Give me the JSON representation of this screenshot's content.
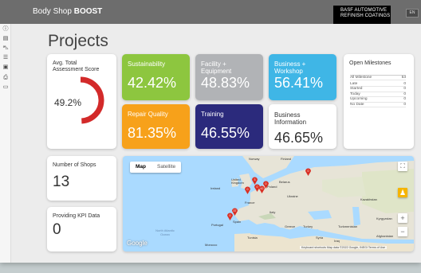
{
  "header": {
    "brand_light": "Body Shop ",
    "brand_bold": "BOOST",
    "partner_line1": "BASF AUTOMOTIVE",
    "partner_line2": "REFINISH COATINGS",
    "language": "EN"
  },
  "sidebar": {
    "icons": [
      "info-icon",
      "list-icon",
      "car-icon",
      "tasks-icon",
      "calendar-icon",
      "printer-icon",
      "monitor-icon"
    ]
  },
  "page": {
    "title": "Projects"
  },
  "assessment": {
    "label": "Avg. Total Assessment Score",
    "value": "49.2%",
    "fraction": 0.492,
    "color": "#d32a2a"
  },
  "kpis": [
    {
      "label": "Sustainability",
      "value": "42.42%",
      "color": "#8dc63f"
    },
    {
      "label": "Facility + Equipment",
      "value": "48.83%",
      "color": "#b1b3b6"
    },
    {
      "label": "Business + Workshop",
      "value": "56.41%",
      "color": "#3fb6e6"
    },
    {
      "label": "Repair Quality",
      "value": "81.35%",
      "color": "#f7a11a"
    },
    {
      "label": "Training",
      "value": "46.55%",
      "color": "#2b2a7c"
    },
    {
      "label": "Business Information",
      "value": "46.65%",
      "color": "#ffffff"
    }
  ],
  "milestones": {
    "title": "Open Milestones",
    "rows": [
      {
        "label": "All Milestone",
        "value": "53"
      },
      {
        "label": "Late",
        "value": "0"
      },
      {
        "label": "Started",
        "value": "0"
      },
      {
        "label": "Today",
        "value": "0"
      },
      {
        "label": "Upcoming",
        "value": "0"
      },
      {
        "label": "No Date",
        "value": "0"
      }
    ]
  },
  "shops": {
    "label": "Number of Shops",
    "value": "13"
  },
  "kpi_data": {
    "label": "Providing KPI Data",
    "value": "0"
  },
  "map": {
    "tab_map": "Map",
    "tab_satellite": "Satellite",
    "labels": {
      "norway": "Norway",
      "finland": "Finland",
      "ireland": "Ireland",
      "united_kingdom": "United Kingdom",
      "poland": "Poland",
      "belarus": "Belarus",
      "ukraine": "Ukraine",
      "kazakhstan": "Kazakhstan",
      "france": "France",
      "italy": "Italy",
      "portugal": "Portugal",
      "spain": "Spain",
      "greece": "Greece",
      "turkey": "Turkey",
      "turkmenistan": "Turkmenistan",
      "kyrgyzstan": "Kyrgyzstan",
      "afghanistan": "Afghanistan",
      "syria": "Syria",
      "iraq": "Iraq",
      "tunisia": "Tunisia",
      "morocco": "Morocco",
      "atlantic": "North Atlantic Ocean"
    },
    "pins": [
      "0",
      "3",
      "0",
      "42",
      "0",
      "37",
      "0",
      "0"
    ],
    "google": "Google",
    "attribution": "Keyboard shortcuts   Map data ©2022 Google, INEGI   Terms of Use"
  }
}
